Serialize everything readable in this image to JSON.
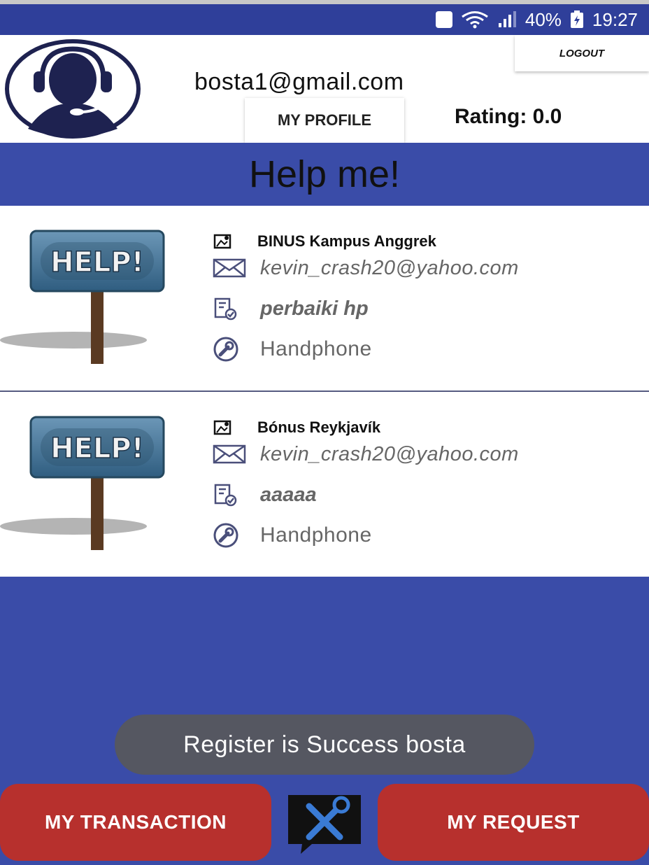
{
  "status_bar": {
    "battery": "40%",
    "time": "19:27"
  },
  "header": {
    "email": "bosta1@gmail.com",
    "logout_label": "LOGOUT",
    "profile_label": "MY PROFILE",
    "rating": "Rating: 0.0"
  },
  "title": "Help me!",
  "requests": [
    {
      "sign_text": "HELP!",
      "location": "BINUS Kampus Anggrek",
      "email": "kevin_crash20@yahoo.com",
      "description": "perbaiki hp",
      "category": "Handphone"
    },
    {
      "sign_text": "HELP!",
      "location": "Bónus Reykjavík",
      "email": "kevin_crash20@yahoo.com",
      "description": "aaaaa",
      "category": "Handphone"
    }
  ],
  "toast": "Register is Success  bosta",
  "nav": {
    "transaction_label": "MY TRANSACTION",
    "request_label": "MY REQUEST"
  },
  "colors": {
    "primary": "#3a4ca8",
    "status_bar": "#2f3f9a",
    "button": "#b7302d",
    "toast": "#555761"
  },
  "icons": [
    "battery-saver-icon",
    "wifi-icon",
    "signal-icon",
    "battery-icon",
    "support-agent-icon",
    "help-sign-icon",
    "map-icon",
    "mail-icon",
    "task-icon",
    "wrench-icon",
    "tools-chat-icon"
  ]
}
